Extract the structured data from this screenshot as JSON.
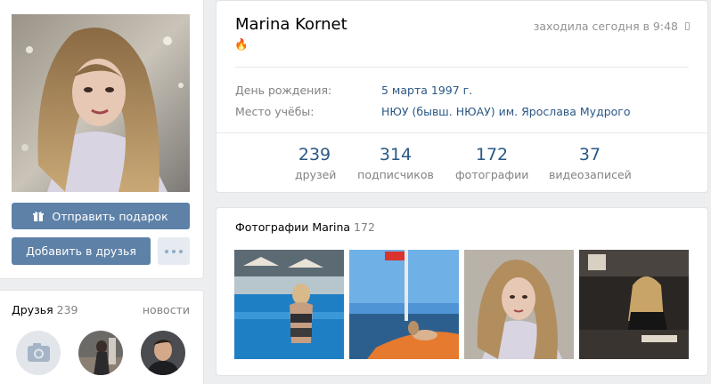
{
  "profile": {
    "name": "Marina Kornet",
    "status_emoji": "🔥",
    "online": "заходила сегодня в 9:48",
    "birthday_label": "День рождения:",
    "birthday_value": "5 марта 1997 г.",
    "education_label": "Место учёбы:",
    "education_value": "НЮУ (бывш. НЮАУ) им. Ярослава Мудрого"
  },
  "counters": [
    {
      "value": "239",
      "label": "друзей"
    },
    {
      "value": "314",
      "label": "подписчиков"
    },
    {
      "value": "172",
      "label": "фотографии"
    },
    {
      "value": "37",
      "label": "видеозаписей"
    }
  ],
  "actions": {
    "gift": "Отправить подарок",
    "add_friend": "Добавить в друзья"
  },
  "friends": {
    "title": "Друзья",
    "count": "239",
    "news_link": "новости"
  },
  "photos": {
    "title": "Фотографии Marina",
    "count": "172"
  },
  "colors": {
    "link": "#2a5885",
    "button": "#5e81a8",
    "page_bg": "#edeef0"
  }
}
